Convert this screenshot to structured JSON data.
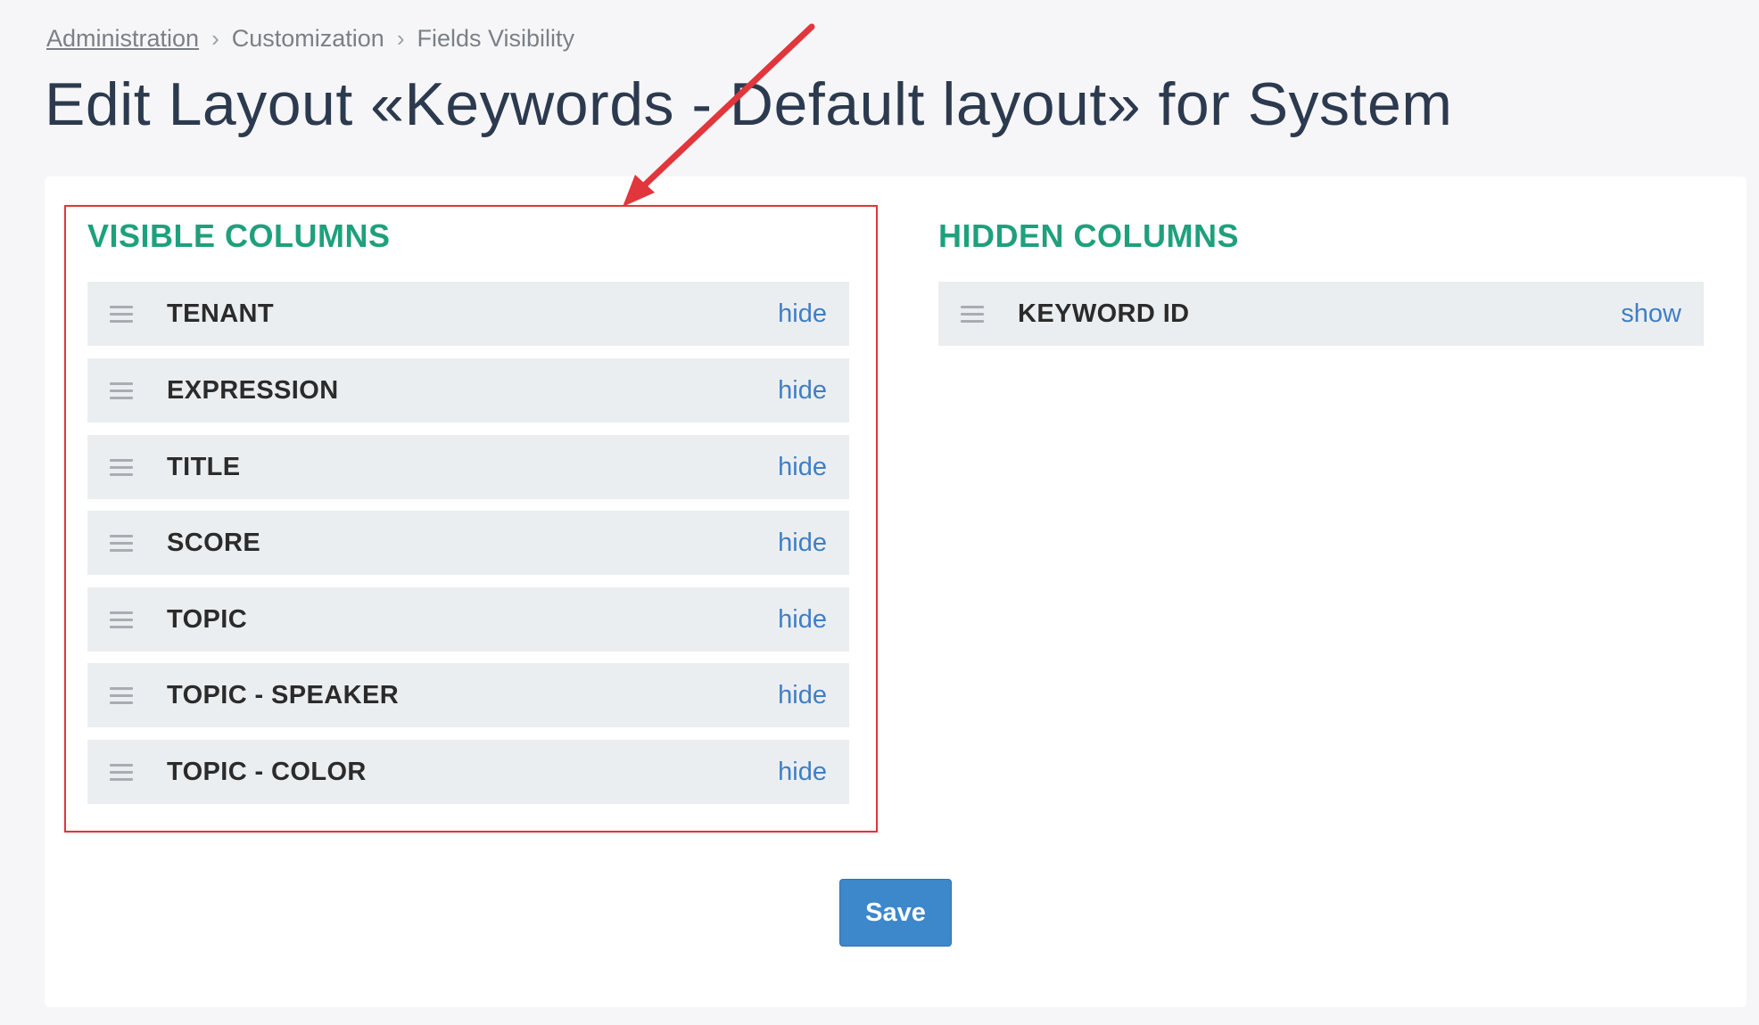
{
  "breadcrumb": [
    "Administration",
    "Customization",
    "Fields Visibility"
  ],
  "page_title": "Edit Layout «Keywords - Default layout» for System",
  "visible_columns": {
    "heading": "VISIBLE COLUMNS",
    "items": [
      {
        "label": "TENANT",
        "action": "hide"
      },
      {
        "label": "EXPRESSION",
        "action": "hide"
      },
      {
        "label": "TITLE",
        "action": "hide"
      },
      {
        "label": "SCORE",
        "action": "hide"
      },
      {
        "label": "TOPIC",
        "action": "hide"
      },
      {
        "label": "TOPIC - SPEAKER",
        "action": "hide"
      },
      {
        "label": "TOPIC - COLOR",
        "action": "hide"
      }
    ]
  },
  "hidden_columns": {
    "heading": "HIDDEN COLUMNS",
    "items": [
      {
        "label": "KEYWORD ID",
        "action": "show"
      }
    ]
  },
  "save_label": "Save",
  "colors": {
    "heading": "#1fa07d",
    "link": "#3f7fc4",
    "annotation": "#e1363c",
    "save_button": "#3d87cb"
  }
}
